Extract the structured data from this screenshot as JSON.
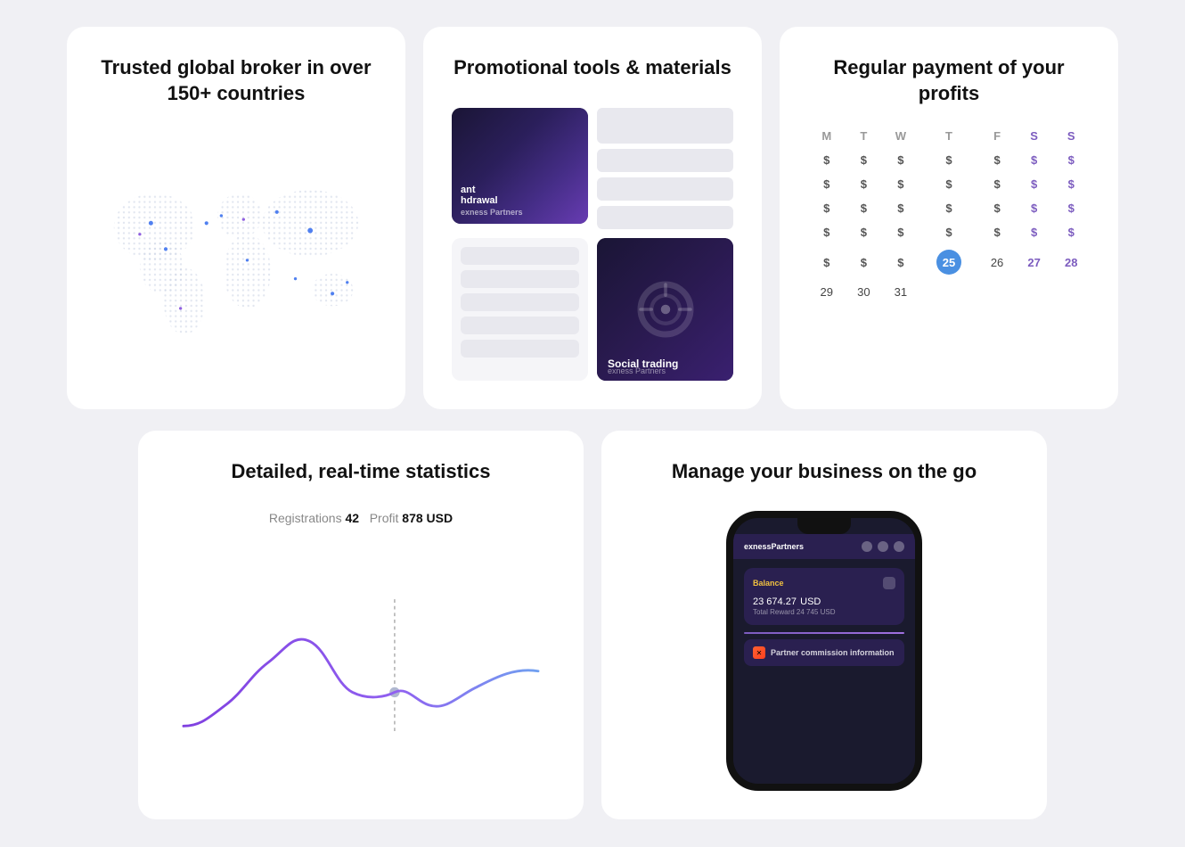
{
  "card1": {
    "title": "Trusted global broker in over 150+ countries"
  },
  "card2": {
    "title": "Promotional tools & materials",
    "item1_text": "ant\nhdrawal",
    "item1_brand": "exness Partners",
    "social_label": "Social trading",
    "social_brand": "exness Partners"
  },
  "card3": {
    "title": "Regular payment of your profits",
    "days": [
      "M",
      "T",
      "W",
      "T",
      "F",
      "S",
      "S"
    ],
    "today": "25",
    "day26": "26",
    "day27": "27",
    "day28": "28",
    "day29": "29",
    "day30": "30",
    "day31": "31"
  },
  "card4": {
    "title": "Detailed, real-time statistics",
    "registrations_label": "Registrations",
    "registrations_value": "42",
    "profit_label": "Profit",
    "profit_value": "878 USD"
  },
  "card5": {
    "title": "Manage your business on the go",
    "brand": "exnessPartners",
    "balance_label": "Balance",
    "balance_amount": "23 674",
    "balance_cents": ".27",
    "balance_currency": "USD",
    "balance_sub": "Total Reward 24 745 USD",
    "commission_label": "Partner commission information"
  }
}
